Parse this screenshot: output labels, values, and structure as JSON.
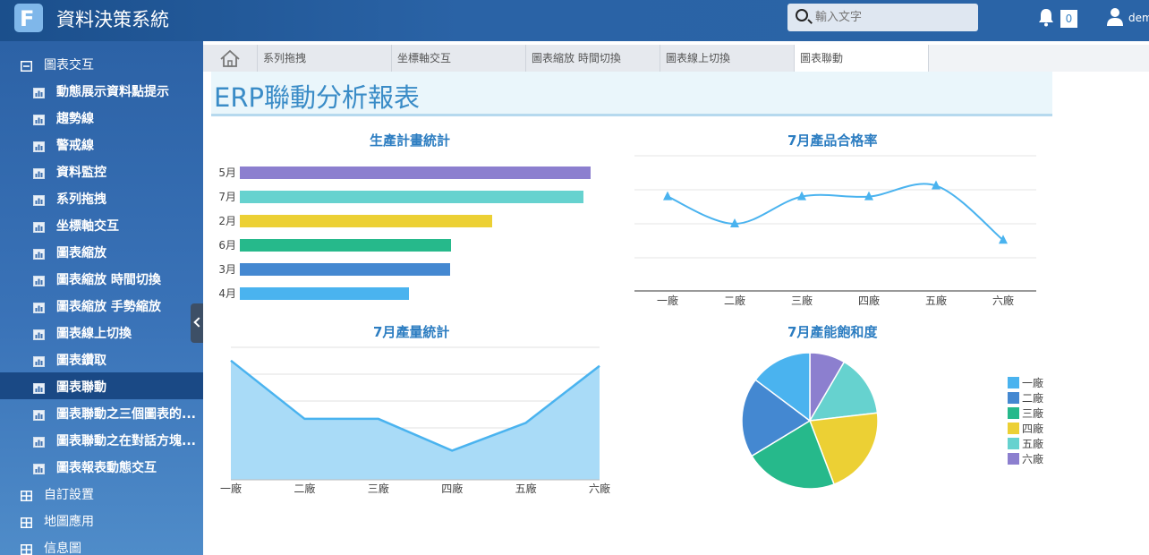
{
  "header": {
    "app_title": "資料決策系統",
    "logo_letter": "F",
    "search_placeholder": "輸入文字",
    "notification_count": "0",
    "username": "demo"
  },
  "sidebar": {
    "group": "圖表交互",
    "items": [
      "動態展示資料點提示",
      "趨勢線",
      "警戒線",
      "資料監控",
      "系列拖拽",
      "坐標軸交互",
      "圖表縮放",
      "圖表縮放 時間切換",
      "圖表縮放 手勢縮放",
      "圖表線上切換",
      "圖表鑽取",
      "圖表聯動",
      "圖表聯動之三個圖表的...",
      "圖表聯動之在對話方塊...",
      "圖表報表動態交互"
    ],
    "active_index": 11,
    "other_groups": [
      "自訂設置",
      "地圖應用",
      "信息圖"
    ]
  },
  "tabs": {
    "items": [
      "系列拖拽",
      "坐標軸交互",
      "圖表縮放 時間切換",
      "圖表線上切換",
      "圖表聯動"
    ],
    "active_index": 4
  },
  "report": {
    "title": "ERP聯動分析報表"
  },
  "chart_data": [
    {
      "type": "bar",
      "orientation": "horizontal",
      "title": "生產計畫統計",
      "categories": [
        "5月",
        "7月",
        "2月",
        "6月",
        "3月",
        "4月"
      ],
      "values": [
        392,
        384,
        282,
        236,
        235,
        189
      ],
      "colors": [
        "#8c7fcf",
        "#66d2cf",
        "#ecd034",
        "#26b98b",
        "#4488d1",
        "#4ab3ef"
      ]
    },
    {
      "type": "line",
      "title": "7月產品合格率",
      "categories": [
        "一廠",
        "二廠",
        "三廠",
        "四廠",
        "五廠",
        "六廠"
      ],
      "values": [
        85,
        75,
        85,
        85,
        89,
        69
      ],
      "ylim": [
        50,
        100
      ],
      "color": "#4ab3ef"
    },
    {
      "type": "area",
      "title": "7月產量統計",
      "categories": [
        "一廠",
        "二廠",
        "三廠",
        "四廠",
        "五廠",
        "六廠"
      ],
      "values": [
        90,
        46,
        46,
        22,
        43,
        86
      ],
      "ylim": [
        0,
        100
      ],
      "color": "#4ab3ef"
    },
    {
      "type": "pie",
      "title": "7月產能飽和度",
      "categories": [
        "一廠",
        "二廠",
        "三廠",
        "四廠",
        "五廠",
        "六廠"
      ],
      "values": [
        14,
        18,
        21,
        20,
        14,
        8
      ],
      "colors": [
        "#4ab3ef",
        "#4488d1",
        "#26b98b",
        "#ecd034",
        "#66d2cf",
        "#8c7fcf"
      ],
      "legend": "right"
    }
  ]
}
